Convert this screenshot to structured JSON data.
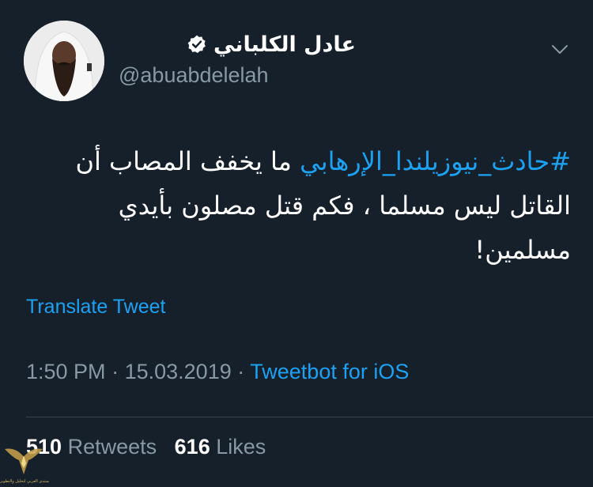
{
  "tweet": {
    "display_name": "عادل الكلباني",
    "verified_icon": "verified-badge-icon",
    "handle": "@abuabdelelah",
    "menu_icon": "chevron-down-icon",
    "body": {
      "hashtag": "#حادث_نيوزيلندا_الإرهابي",
      "text": " ما يخفف المصاب أن القاتل ليس مسلما ، فكم قتل مصلون بأيدي مسلمين!"
    },
    "translate_label": "Translate Tweet",
    "time": "1:50 PM",
    "separator": "·",
    "date": "15.03.2019",
    "source": "Tweetbot for iOS",
    "retweets_count": "510",
    "retweets_label": "Retweets",
    "likes_count": "616",
    "likes_label": "Likes"
  },
  "watermark": {
    "text": "المنتدى العربي لتحليل والتطوير"
  },
  "colors": {
    "background": "#15202b",
    "accent": "#1da1f2",
    "muted": "#8899a6",
    "divider": "#38444d"
  }
}
